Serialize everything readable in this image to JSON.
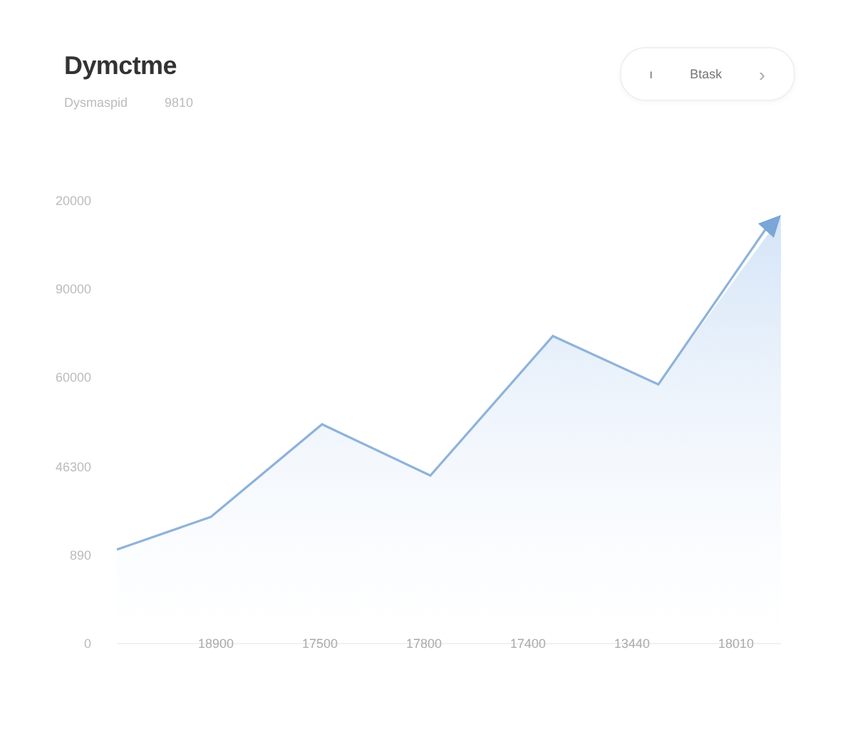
{
  "header": {
    "title": "Dymctme",
    "subtitle": "Dysmaspid",
    "subtitle_value": "9810"
  },
  "nav": {
    "prev": "ı",
    "label": "Btask",
    "next": "›"
  },
  "chart": {
    "kind": "picture",
    "y_axis_labels": [
      "20000",
      "90000",
      "60000",
      "46300",
      "890",
      "0"
    ],
    "x_axis_labels": [
      "18900",
      "17500",
      "17800",
      "17400",
      "13440",
      "18010"
    ]
  }
}
